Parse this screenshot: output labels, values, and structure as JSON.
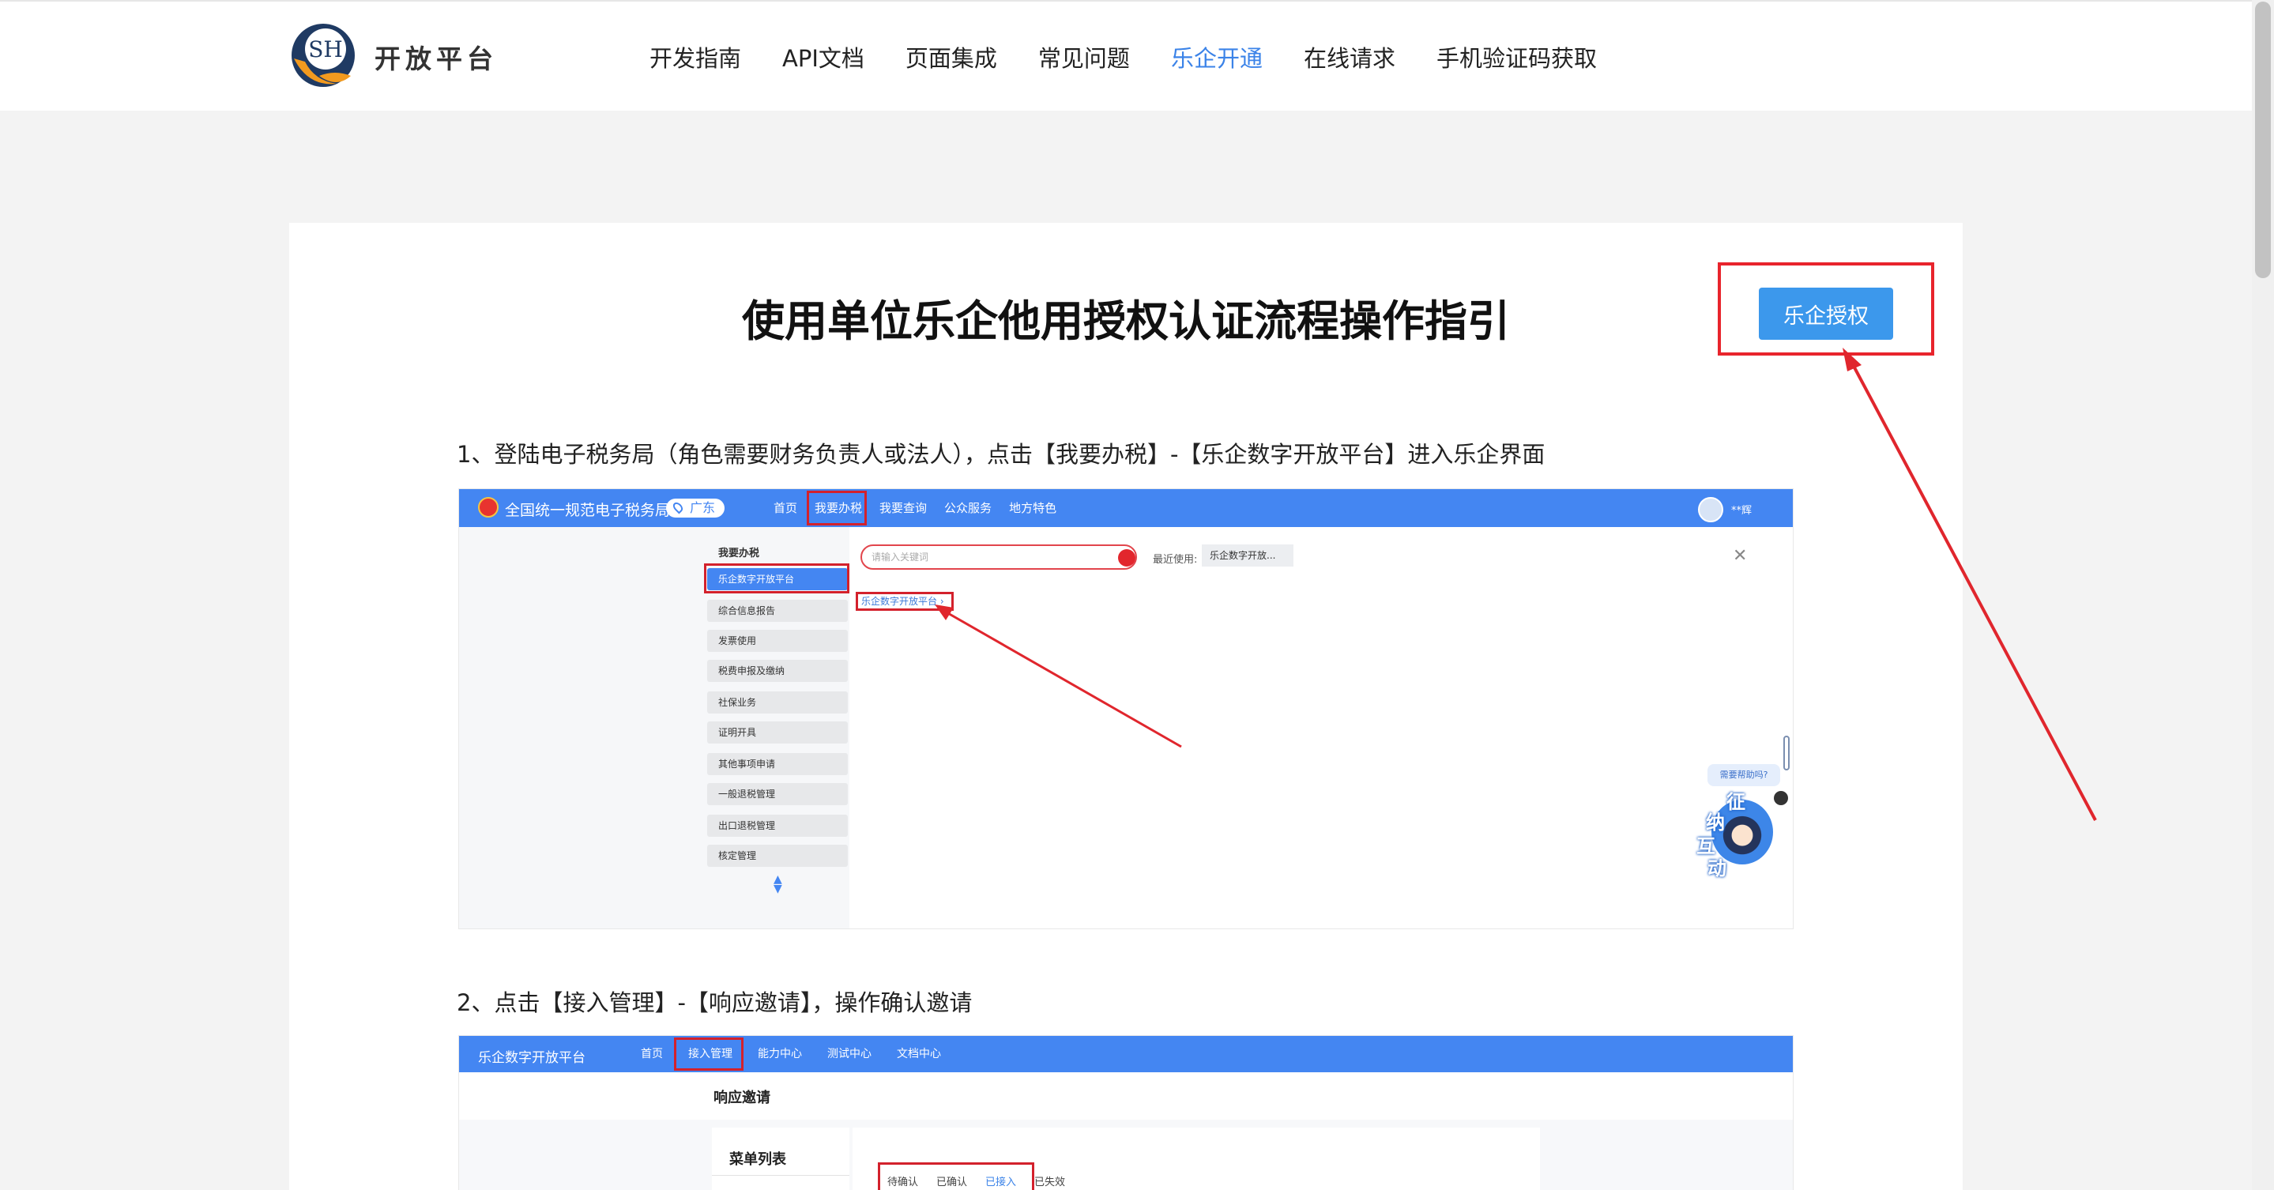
{
  "header": {
    "brand": "开放平台",
    "logo_text": "SH",
    "nav": [
      {
        "label": "开发指南",
        "active": false
      },
      {
        "label": "API文档",
        "active": false
      },
      {
        "label": "页面集成",
        "active": false
      },
      {
        "label": "常见问题",
        "active": false
      },
      {
        "label": "乐企开通",
        "active": true
      },
      {
        "label": "在线请求",
        "active": false
      },
      {
        "label": "手机验证码获取",
        "active": false
      }
    ]
  },
  "colors": {
    "accent": "#3b83e8",
    "highlight_red": "#e8242c",
    "button_blue": "#3c98ec"
  },
  "article": {
    "title": "使用单位乐企他用授权认证流程操作指引",
    "auth_button": "乐企授权",
    "step1": "1、登陆电子税务局（角色需要财务负责人或法人），点击【我要办税】-【乐企数字开放平台】进入乐企界面",
    "step2": "2、点击【接入管理】-【响应邀请】，操作确认邀请"
  },
  "shot1": {
    "site_name": "全国统一规范电子税务局",
    "region": "广东",
    "menu": [
      "首页",
      "我要办税",
      "我要查询",
      "公众服务",
      "地方特色"
    ],
    "user": "**辉",
    "sidebar_title": "我要办税",
    "sidebar_items": [
      "乐企数字开放平台",
      "综合信息报告",
      "发票使用",
      "税费申报及缴纳",
      "社保业务",
      "证明开具",
      "其他事项申请",
      "一般退税管理",
      "出口退税管理",
      "核定管理"
    ],
    "search_placeholder": "请输入关键词",
    "recent_label": "最近使用:",
    "recent_item": "乐企数字开放...",
    "result_link": "乐企数字开放平台 ›",
    "help_text": "需要帮助吗?",
    "mascot_chars": [
      "征",
      "纳",
      "互",
      "动"
    ]
  },
  "shot2": {
    "site_name": "乐企数字开放平台",
    "menu": [
      "首页",
      "接入管理",
      "能力中心",
      "测试中心",
      "文档中心"
    ],
    "heading": "响应邀请",
    "panel_title": "菜单列表",
    "tabs": [
      "待确认",
      "已确认",
      "已接入",
      "已失效"
    ],
    "active_tab": "已接入"
  }
}
